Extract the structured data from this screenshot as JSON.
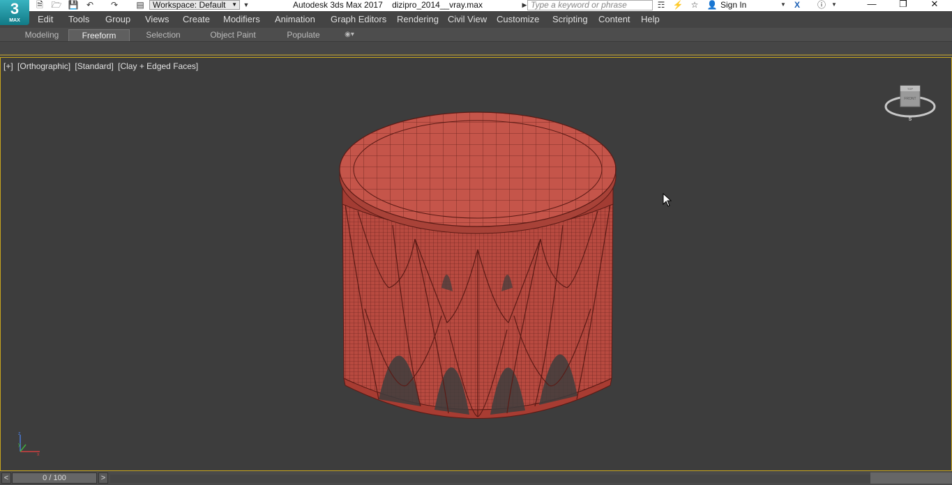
{
  "app": {
    "logo_text": "3",
    "logo_sub": "MAX",
    "workspace": "Workspace: Default",
    "window_title": "Autodesk 3ds Max 2017",
    "file_name": "dizipro_2014__vray.max",
    "search_placeholder": "Type a keyword or phrase",
    "sign_in": "Sign In"
  },
  "menu": [
    "Edit",
    "Tools",
    "Group",
    "Views",
    "Create",
    "Modifiers",
    "Animation",
    "Graph Editors",
    "Rendering",
    "Civil View",
    "Customize",
    "Scripting",
    "Content",
    "Help"
  ],
  "ribbon_tabs": [
    {
      "label": "Modeling",
      "active": false
    },
    {
      "label": "Freeform",
      "active": true
    },
    {
      "label": "Selection",
      "active": false
    },
    {
      "label": "Object Paint",
      "active": false
    },
    {
      "label": "Populate",
      "active": false
    }
  ],
  "viewport": {
    "label_parts": [
      "[+]",
      "[Orthographic]",
      "[Standard]",
      "[Clay + Edged Faces]"
    ],
    "viewcube_face": "FRONT",
    "viewcube_top": "TOP",
    "compass_s": "S",
    "axis": {
      "x": "x",
      "y": "y",
      "z": "z"
    }
  },
  "timeline": {
    "frame": "0 / 100",
    "prev": "<",
    "next": ">"
  },
  "colors": {
    "model_fill": "#b5463c",
    "model_wire": "#5a1a15",
    "viewport_border": "#c8a51e"
  }
}
